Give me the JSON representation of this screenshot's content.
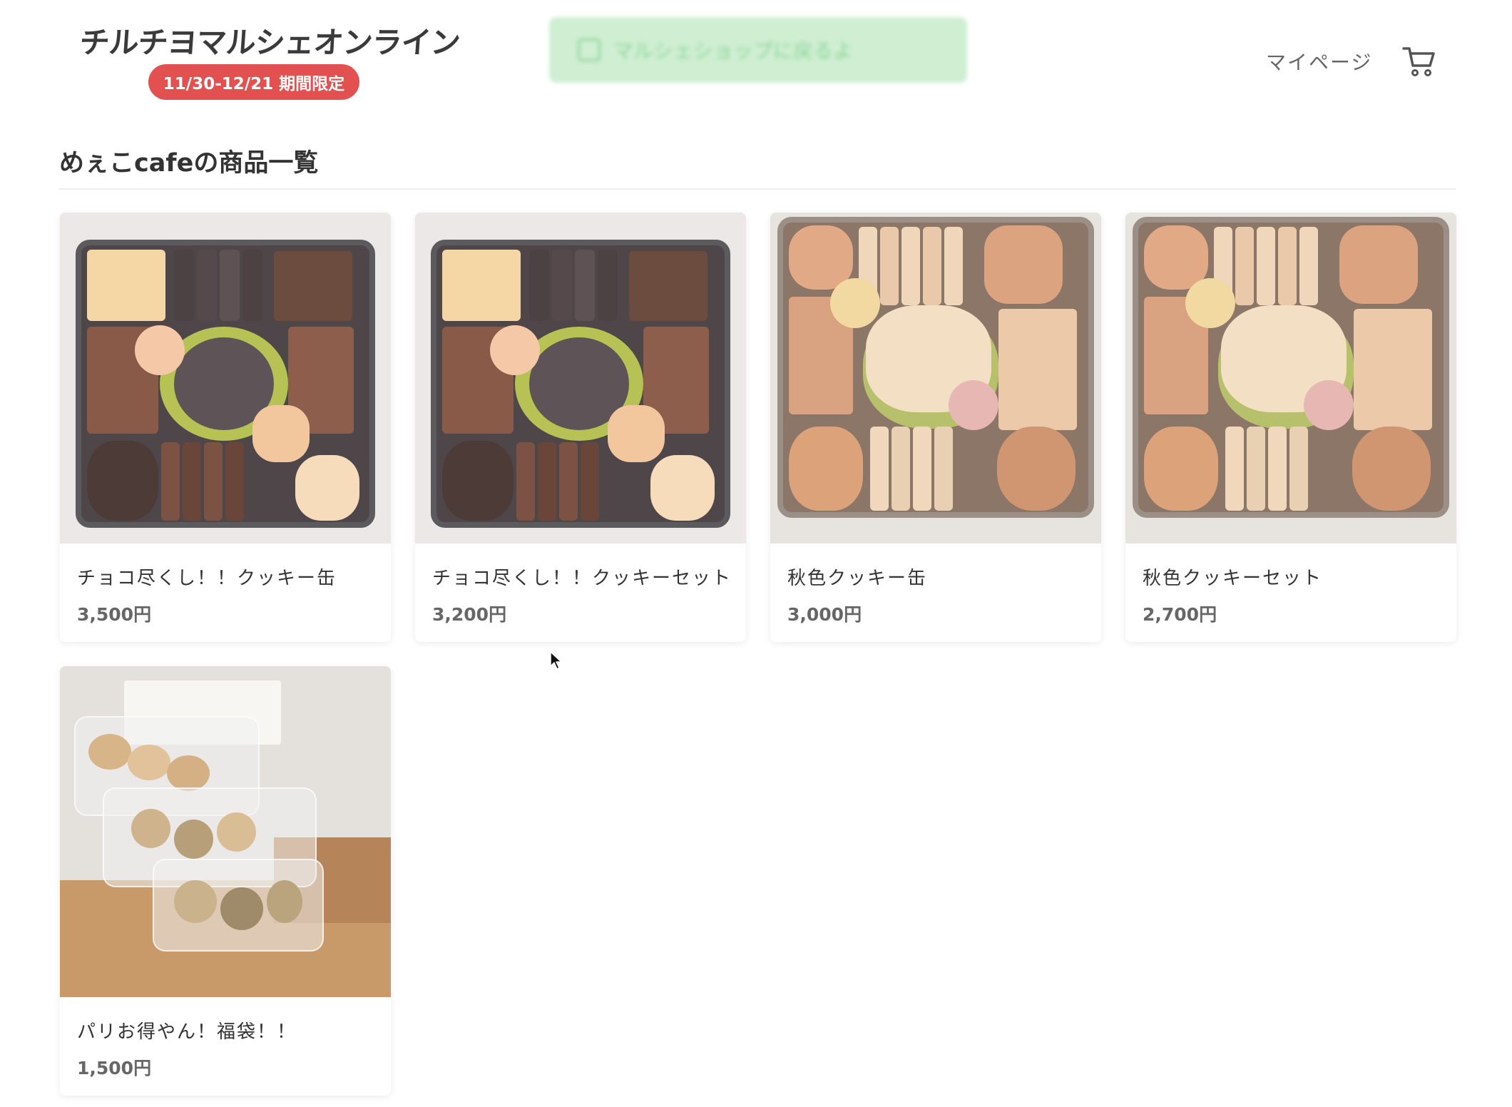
{
  "header": {
    "logo_text": "チルチヨマルシェオンライン",
    "period_badge": "11/30-12/21 期間限定",
    "banner_text": "マルシェショップに戻るよ",
    "mypage_label": "マイページ",
    "cart_icon": "cart-icon"
  },
  "shop": {
    "title": "めぇこcafeの商品一覧"
  },
  "products": [
    {
      "name": "チョコ尽くし！！クッキー缶",
      "price": "3,500円"
    },
    {
      "name": "チョコ尽くし！！クッキーセット",
      "price": "3,200円"
    },
    {
      "name": "秋色クッキー缶",
      "price": "3,000円"
    },
    {
      "name": "秋色クッキーセット",
      "price": "2,700円"
    },
    {
      "name": "パリお得やん！福袋！！",
      "price": "1,500円"
    }
  ],
  "colors": {
    "accent_red": "#e35050",
    "banner_green": "#cfeed2",
    "text": "#333333"
  }
}
